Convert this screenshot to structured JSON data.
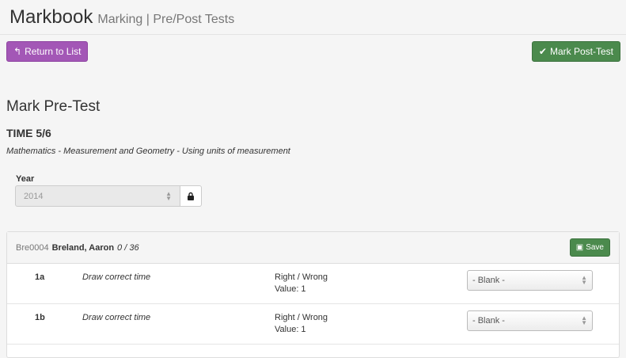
{
  "header": {
    "title": "Markbook",
    "subtitle": "Marking | Pre/Post Tests"
  },
  "toolbar": {
    "return_label": "Return to List",
    "mark_post_label": "Mark Post-Test"
  },
  "section": {
    "title": "Mark Pre-Test",
    "test_code": "TIME 5/6",
    "description": "Mathematics - Measurement and Geometry - Using units of measurement"
  },
  "year": {
    "label": "Year",
    "value": "2014"
  },
  "student": {
    "id": "Bre0004",
    "name": "Breland, Aaron",
    "score": "0 / 36",
    "save_label": "Save"
  },
  "questions": [
    {
      "num": "1a",
      "text": "Draw correct time",
      "type": "Right / Wrong",
      "value": "Value: 1",
      "selected": "- Blank -"
    },
    {
      "num": "1b",
      "text": "Draw correct time",
      "type": "Right / Wrong",
      "value": "Value: 1",
      "selected": "- Blank -"
    }
  ]
}
